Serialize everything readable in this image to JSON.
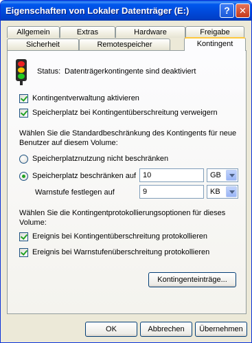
{
  "window": {
    "title": "Eigenschaften von Lokaler Datenträger (E:)",
    "help_label": "?",
    "close_label": "✕"
  },
  "tabs": {
    "row_top": [
      "Allgemein",
      "Extras",
      "Hardware",
      "Freigabe"
    ],
    "row_bottom": [
      "Sicherheit",
      "Remotespeicher",
      "Kontingent"
    ],
    "active": "Kontingent"
  },
  "quota": {
    "status_label": "Status:",
    "status_text": "Datenträgerkontingente sind deaktiviert",
    "enable_label": "Kontingentverwaltung aktivieren",
    "enable_checked": true,
    "deny_label": "Speicherplatz bei Kontingentüberschreitung verweigern",
    "deny_checked": true,
    "default_text": "Wählen Sie die Standardbeschränkung des Kontingents für neue Benutzer auf diesem Volume:",
    "no_limit_label": "Speicherplatznutzung nicht beschränken",
    "limit_label": "Speicherplatz beschränken auf",
    "limit_selected": true,
    "limit_value": "10",
    "limit_unit": "GB",
    "warn_label": "Warnstufe festlegen auf",
    "warn_value": "9",
    "warn_unit": "KB",
    "log_text": "Wählen Sie die Kontingentprotokollierungsoptionen für dieses Volume:",
    "log_exceed_label": "Ereignis bei Kontingentüberschreitung protokollieren",
    "log_exceed_checked": true,
    "log_warn_label": "Ereignis bei Warnstufenüberschreitung protokollieren",
    "log_warn_checked": true,
    "entries_button": "Kontingenteinträge..."
  },
  "footer": {
    "ok": "OK",
    "cancel": "Abbrechen",
    "apply": "Übernehmen"
  }
}
